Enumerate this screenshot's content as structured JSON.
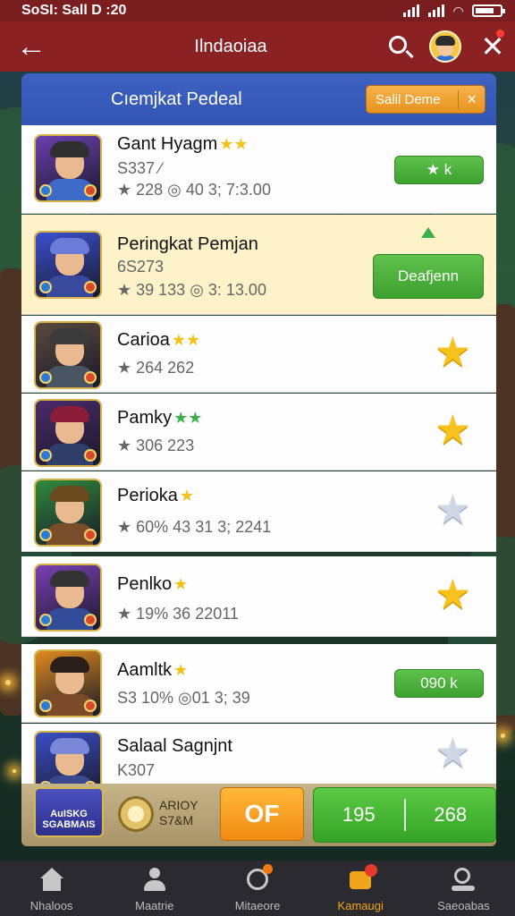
{
  "status_bar": {
    "time": "SoSI: Sall D :20"
  },
  "top_bar": {
    "title": "Ilndaoiaa"
  },
  "header": {
    "title": "Cıemjkat Pedeal",
    "button_label": "Salil Deme",
    "button_close": "×"
  },
  "rows": [
    {
      "name": "Gant Hyagm",
      "stars": "★★",
      "sub": "S337 ∕",
      "meta": "★ 228 ◎ 40 3; 7:3.00",
      "action": "button",
      "button_label": "★  k",
      "thumb_sky": "#6b3fb0",
      "thumb_hat": "#2f2f2f",
      "thumb_body": "#3d6ac7"
    },
    {
      "name": "Peringkat Pemjan",
      "stars": "",
      "sub": "6S273",
      "meta": "★ 39 133 ◎ 3: 13.00",
      "action": "big-button",
      "button_label": "Deafjenn",
      "highlight": true,
      "thumb_sky": "#3b4fd2",
      "thumb_hat": "#6a7bd8",
      "thumb_body": "#394a9c"
    },
    {
      "name": "Carioa",
      "stars": "★★",
      "sub": "",
      "meta": "★ 264 262",
      "action": "star",
      "thumb_sky": "#5a4a3e",
      "thumb_hat": "#3a3a3a",
      "thumb_body": "#4a5563"
    },
    {
      "name": "Pamky",
      "stars": "★★",
      "stars_color": "green",
      "sub": "",
      "meta": "★ 306 223",
      "action": "star",
      "thumb_sky": "#4a2a6a",
      "thumb_hat": "#8b1d3a",
      "thumb_body": "#2f3f6a"
    },
    {
      "name": "Perioka",
      "stars": "★",
      "sub": "",
      "meta": "★ 60% 43 31 3; 2241",
      "action": "star-outline",
      "thumb_sky": "#2f8a3c",
      "thumb_hat": "#6a4a1e",
      "thumb_body": "#7a4d2a"
    },
    {
      "name": "Penlko",
      "stars": "★",
      "sub": "",
      "meta": "★ 19% 36 22011",
      "action": "star",
      "thumb_sky": "#7a3fb4",
      "thumb_hat": "#333333",
      "thumb_body": "#334c9a"
    },
    {
      "name": "Aamltk",
      "stars": "★",
      "sub": "",
      "meta": "S3 10% ◎01 3; 39",
      "action": "button",
      "button_label": "090  k",
      "thumb_sky": "#e08a1e",
      "thumb_hat": "#2a1f1a",
      "thumb_body": "#7a4a2a"
    },
    {
      "name": "Salaal Sagnjnt",
      "stars": "",
      "sub": "K307",
      "meta": "",
      "action": "star-outline",
      "thumb_sky": "#3a4ec8",
      "thumb_hat": "#7b88d8",
      "thumb_body": "#3a4a8c"
    }
  ],
  "action_bar": {
    "badge_text": "AuISKG SGABMAIS",
    "coin_label_line1": "ARIOY",
    "coin_label_line2": "S7&M",
    "orange_label": "OF",
    "green_left": "195",
    "green_right": "268"
  },
  "bottom_nav": [
    {
      "label": "Nhaloos",
      "icon": "home-icon"
    },
    {
      "label": "Maatrie",
      "icon": "user-icon"
    },
    {
      "label": "Mitaeore",
      "icon": "clock-icon"
    },
    {
      "label": "Kamaugi",
      "icon": "inbox-icon",
      "active": true
    },
    {
      "label": "Saeoabas",
      "icon": "search-person-icon"
    }
  ],
  "colors": {
    "status_bar": "#7a1d1f",
    "top_bar": "#8a2224",
    "header": "#3e62c2",
    "accent_orange": "#f08b12",
    "accent_green": "#3da030",
    "star": "#f7c21c"
  }
}
